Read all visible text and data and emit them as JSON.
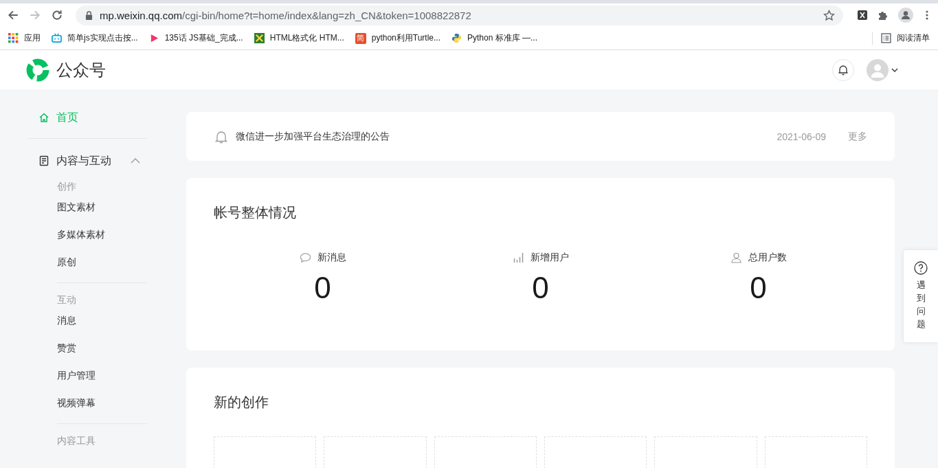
{
  "browser": {
    "url_host": "mp.weixin.qq.com",
    "url_path": "/cgi-bin/home?t=home/index&lang=zh_CN&token=1008822872",
    "bookmarks": [
      {
        "kind": "apps",
        "label": "应用"
      },
      {
        "kind": "tv",
        "label": "简单js实现点击按..."
      },
      {
        "kind": "play",
        "label": "135话 JS基础_完成..."
      },
      {
        "kind": "tools",
        "label": "HTML格式化 HTM..."
      },
      {
        "kind": "letter",
        "label": "python利用Turtle...",
        "icon_text": "简"
      },
      {
        "kind": "python",
        "label": "Python 标准库 —..."
      }
    ],
    "reading_list": "阅读清单"
  },
  "header": {
    "logo_text": "公众号"
  },
  "sidebar": {
    "items": [
      {
        "kind": "link",
        "label": "首页",
        "selected": true
      },
      {
        "kind": "section",
        "label": "内容与互动",
        "expanded": true,
        "groups": [
          {
            "heading": "创作",
            "items": [
              "图文素材",
              "多媒体素材",
              "原创"
            ]
          },
          {
            "heading": "互动",
            "items": [
              "消息",
              "赞赏",
              "用户管理",
              "视频弹幕"
            ]
          },
          {
            "heading": "内容工具"
          }
        ]
      }
    ]
  },
  "notice": {
    "text": "微信进一步加强平台生态治理的公告",
    "date": "2021-06-09",
    "more": "更多"
  },
  "overview": {
    "title": "帐号整体情况",
    "stats": [
      {
        "kind": "message",
        "label": "新消息",
        "value": "0"
      },
      {
        "kind": "growth",
        "label": "新增用户",
        "value": "0"
      },
      {
        "kind": "user",
        "label": "总用户数",
        "value": "0"
      }
    ]
  },
  "creation": {
    "title": "新的创作"
  },
  "help": {
    "label": "遇到问题"
  }
}
